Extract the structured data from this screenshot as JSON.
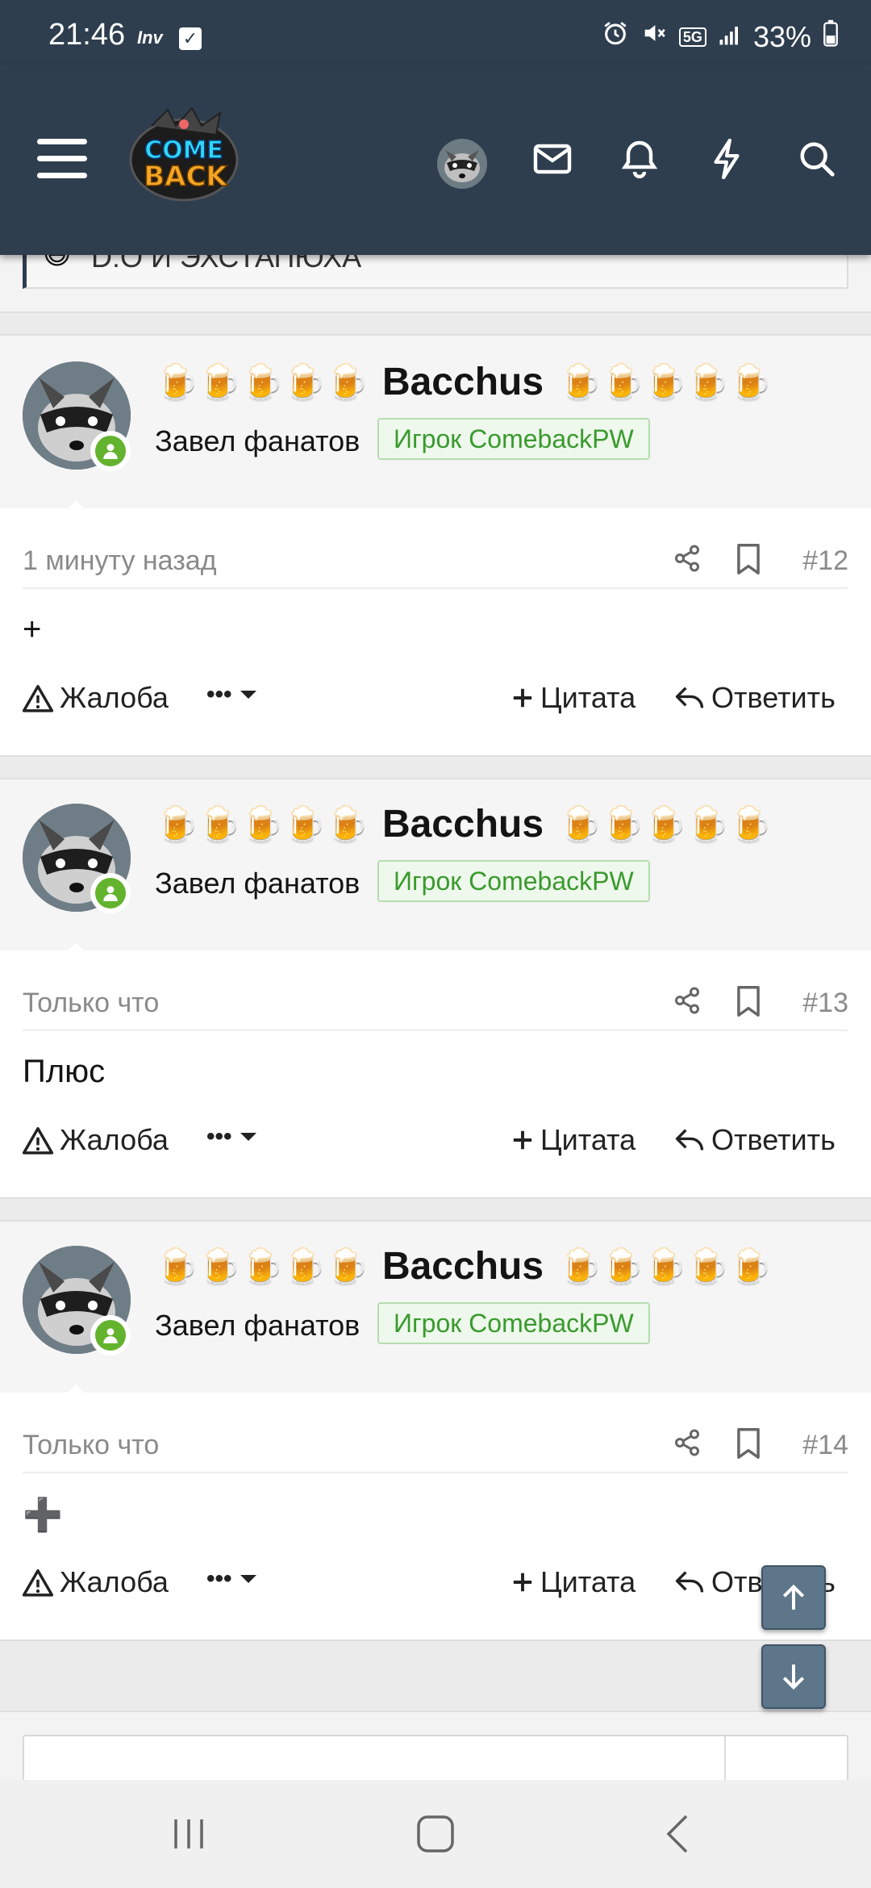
{
  "status_bar": {
    "time": "21:46",
    "carrier": "Inv",
    "battery": "33%",
    "network": "5G"
  },
  "header": {
    "logo_line1": "COME",
    "logo_line2": "BACK"
  },
  "quote_remnant": {
    "text": "D:O И ЭХСТАПЮХА"
  },
  "posts": [
    {
      "username": "Bacchus",
      "beer_prefix": "🍺🍺🍺🍺🍺",
      "beer_suffix": "🍺🍺🍺🍺🍺",
      "user_title": "Завел фанатов",
      "badge": "Игрок ComebackPW",
      "time": "1 минуту назад",
      "number": "#12",
      "content": "+",
      "report_label": "Жалоба",
      "more_label": "•••",
      "quote_label": "Цитата",
      "reply_label": "Ответить"
    },
    {
      "username": "Bacchus",
      "beer_prefix": "🍺🍺🍺🍺🍺",
      "beer_suffix": "🍺🍺🍺🍺🍺",
      "user_title": "Завел фанатов",
      "badge": "Игрок ComebackPW",
      "time": "Только что",
      "number": "#13",
      "content": "Плюс",
      "report_label": "Жалоба",
      "more_label": "•••",
      "quote_label": "Цитата",
      "reply_label": "Ответить"
    },
    {
      "username": "Bacchus",
      "beer_prefix": "🍺🍺🍺🍺🍺",
      "beer_suffix": "🍺🍺🍺🍺🍺",
      "user_title": "Завел фанатов",
      "badge": "Игрок ComebackPW",
      "time": "Только что",
      "number": "#14",
      "content": "➕",
      "report_label": "Жалоба",
      "more_label": "•••",
      "quote_label": "Цитата",
      "reply_label": "Ответить"
    }
  ],
  "colors": {
    "header": "#2e3e4f",
    "online": "#63b32e",
    "badge_text": "#3a9a2e",
    "fab": "#5d7689"
  }
}
